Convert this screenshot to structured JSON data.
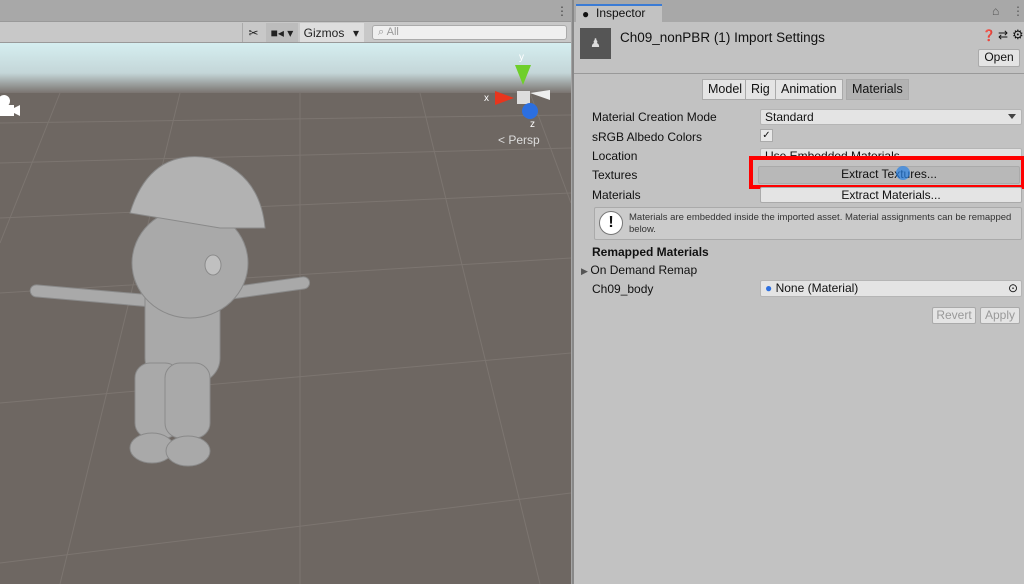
{
  "scene": {
    "toolbar": {
      "gizmos_label": "Gizmos",
      "search_placeholder": "All"
    },
    "gizmo": {
      "x_label": "x",
      "y_label": "y",
      "z_label": "z",
      "projection": "Persp"
    }
  },
  "inspector": {
    "tab_label": "Inspector",
    "title": "Ch09_nonPBR (1) Import Settings",
    "open_label": "Open",
    "tabs": [
      {
        "label": "Model"
      },
      {
        "label": "Rig"
      },
      {
        "label": "Animation"
      },
      {
        "label": "Materials",
        "active": true
      }
    ],
    "fields": {
      "material_creation_mode": {
        "label": "Material Creation Mode",
        "value": "Standard"
      },
      "srgb": {
        "label": "sRGB Albedo Colors",
        "checked": true
      },
      "location": {
        "label": "Location",
        "value": "Use Embedded Materials"
      },
      "textures": {
        "label": "Textures",
        "button": "Extract Textures..."
      },
      "materials": {
        "label": "Materials",
        "button": "Extract Materials..."
      }
    },
    "info_message": "Materials are embedded inside the imported asset. Material assignments can be remapped below.",
    "remapped_header": "Remapped Materials",
    "on_demand_remap": "On Demand Remap",
    "ch09_body": {
      "label": "Ch09_body",
      "value": "None (Material)"
    },
    "revert_label": "Revert",
    "apply_label": "Apply",
    "highlight_color": "#ff0000"
  }
}
